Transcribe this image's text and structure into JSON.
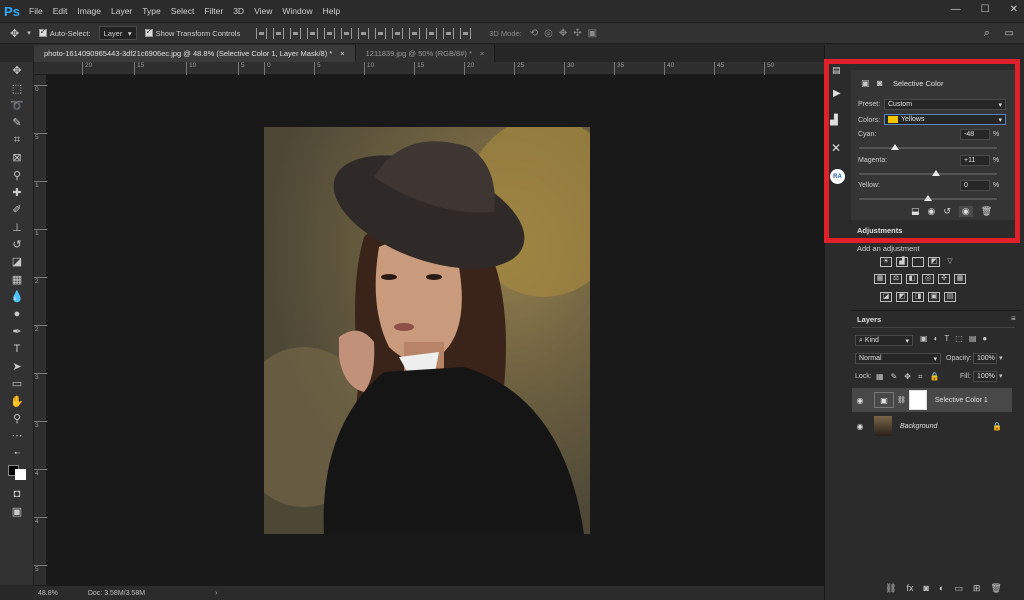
{
  "app": {
    "logo": "Ps"
  },
  "menu": [
    "File",
    "Edit",
    "Image",
    "Layer",
    "Type",
    "Select",
    "Filter",
    "3D",
    "View",
    "Window",
    "Help"
  ],
  "window_controls": [
    "—",
    "☐",
    "✕"
  ],
  "options": {
    "auto_select_label": "Auto-Select:",
    "auto_select_value": "Layer",
    "show_transform_label": "Show Transform Controls",
    "mode_3d_label": "3D Mode:"
  },
  "tabs": [
    {
      "label": "photo-1614090965443-3df21c6906ec.jpg @ 48.8% (Selective Color 1, Layer Mask/8) *",
      "close": "×",
      "active": true
    },
    {
      "label": "1211839.jpg @ 50% (RGB/8#) *",
      "close": "×",
      "active": false
    }
  ],
  "ruler_top": [
    "20",
    "15",
    "10",
    "5",
    "0",
    "5",
    "10",
    "15",
    "20",
    "25",
    "30",
    "35",
    "40",
    "45",
    "50"
  ],
  "ruler_left": [
    "0",
    "5",
    "1",
    "1",
    "2",
    "2",
    "3",
    "3",
    "4",
    "4",
    "5"
  ],
  "status": {
    "zoom": "48.8%",
    "doc": "Doc: 3.58M/3.58M",
    "arrow": "›"
  },
  "properties": {
    "title": "Selective Color",
    "preset_label": "Preset:",
    "preset_value": "Custom",
    "colors_label": "Colors:",
    "colors_value": "Yellows",
    "colors_swatch": "#f2c500",
    "cyan_label": "Cyan:",
    "cyan_value": "-48",
    "cyan_level": -48,
    "magenta_label": "Magenta:",
    "magenta_value": "+11",
    "magenta_level": 11,
    "yellow_label": "Yellow:",
    "yellow_value": "0",
    "yellow_level": 0,
    "percent": "%"
  },
  "adjustments": {
    "tab": "Adjustments",
    "add_label": "Add an adjustment"
  },
  "layers": {
    "tab": "Layers",
    "kind": "Kind",
    "blend_mode": "Normal",
    "opacity_label": "Opacity:",
    "opacity_value": "100%",
    "lock_label": "Lock:",
    "fill_label": "Fill:",
    "fill_value": "100%",
    "items": [
      {
        "name": "Selective Color 1"
      },
      {
        "name": "Background"
      }
    ]
  },
  "dock": {
    "ra_label": "RA"
  },
  "colors": {
    "accent": "#31a8ff",
    "highlight_box": "#e0202a"
  }
}
